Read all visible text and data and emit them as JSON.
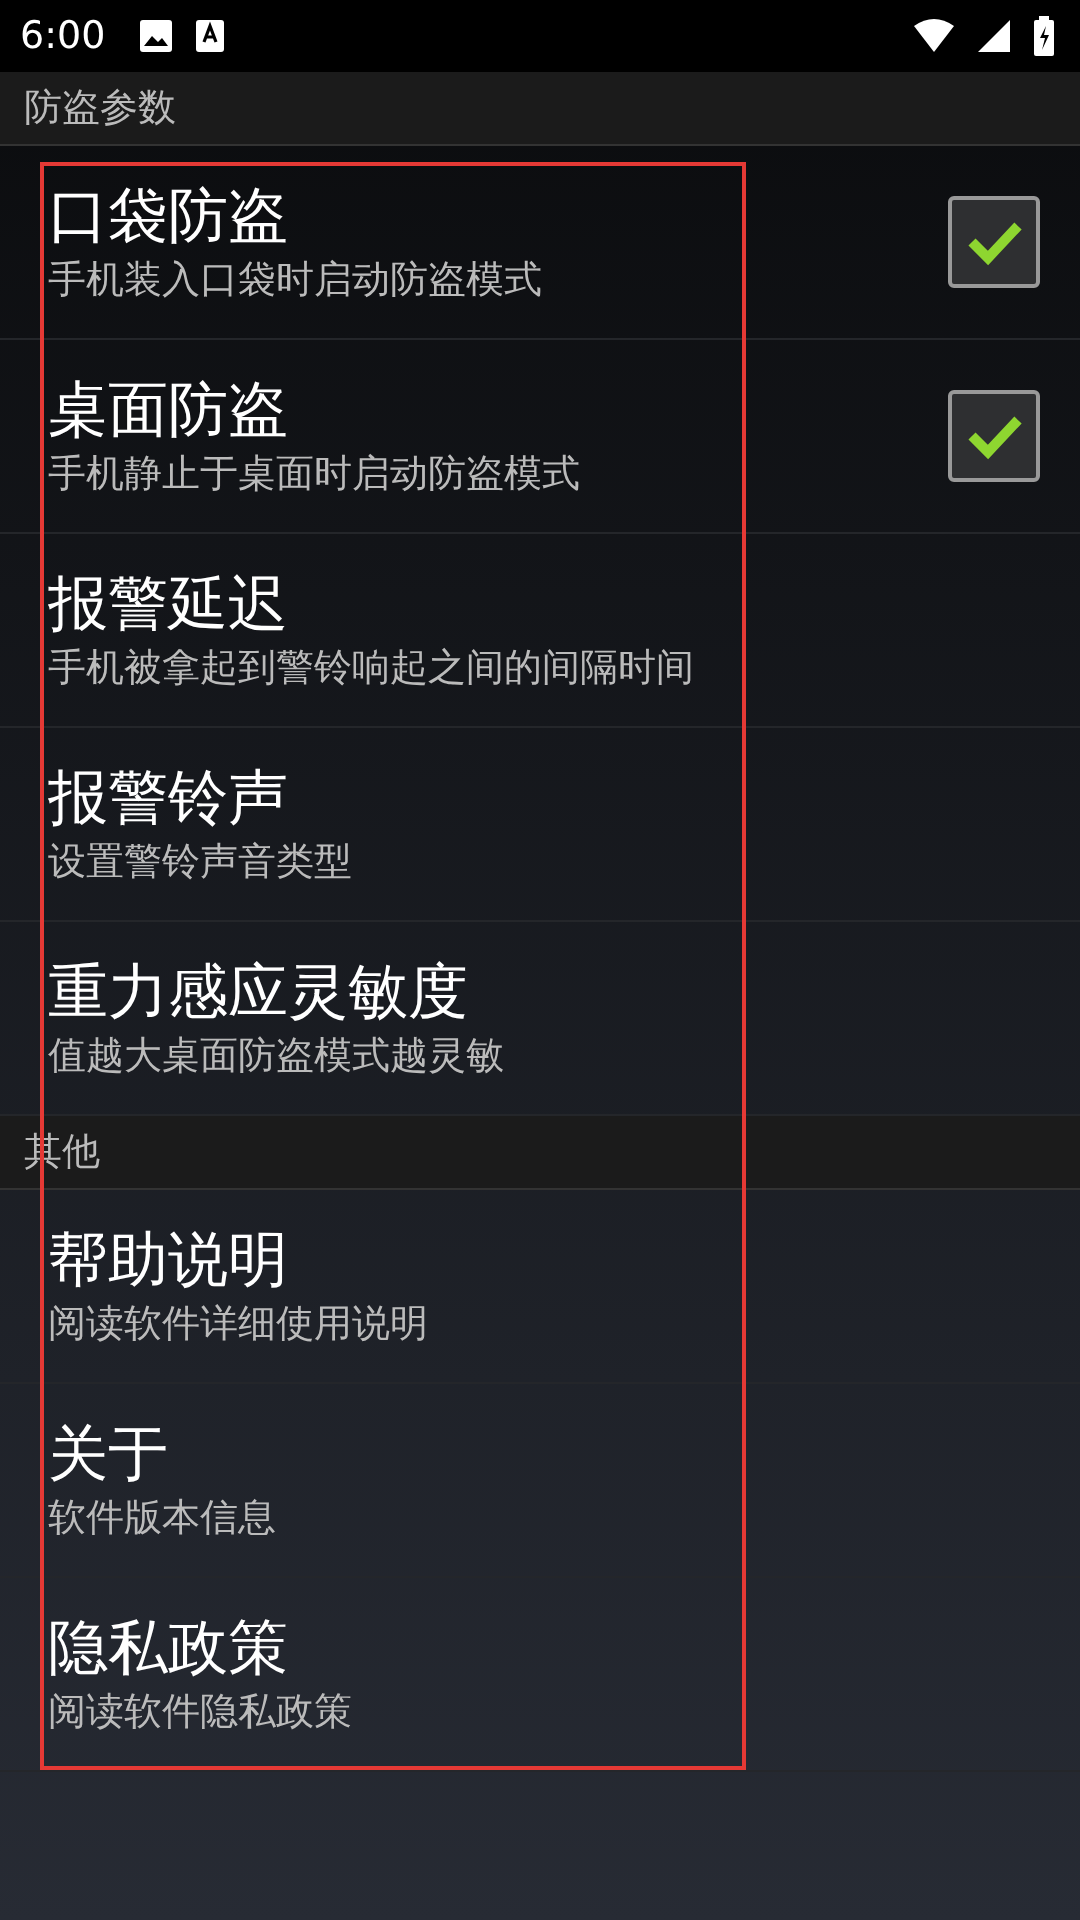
{
  "status_bar": {
    "time": "6:00"
  },
  "sections": [
    {
      "header": "防盗参数",
      "items": [
        {
          "kind": "checkbox",
          "title": "口袋防盗",
          "summary": "手机装入口袋时启动防盗模式",
          "checked": true
        },
        {
          "kind": "checkbox",
          "title": "桌面防盗",
          "summary": "手机静止于桌面时启动防盗模式",
          "checked": true
        },
        {
          "kind": "plain",
          "title": "报警延迟",
          "summary": "手机被拿起到警铃响起之间的间隔时间"
        },
        {
          "kind": "plain",
          "title": "报警铃声",
          "summary": "设置警铃声音类型"
        },
        {
          "kind": "plain",
          "title": "重力感应灵敏度",
          "summary": "值越大桌面防盗模式越灵敏"
        }
      ]
    },
    {
      "header": "其他",
      "items": [
        {
          "kind": "plain",
          "title": "帮助说明",
          "summary": "阅读软件详细使用说明"
        },
        {
          "kind": "plain",
          "title": "关于",
          "summary": "软件版本信息"
        },
        {
          "kind": "plain",
          "title": "隐私政策",
          "summary": "阅读软件隐私政策"
        }
      ]
    }
  ]
}
